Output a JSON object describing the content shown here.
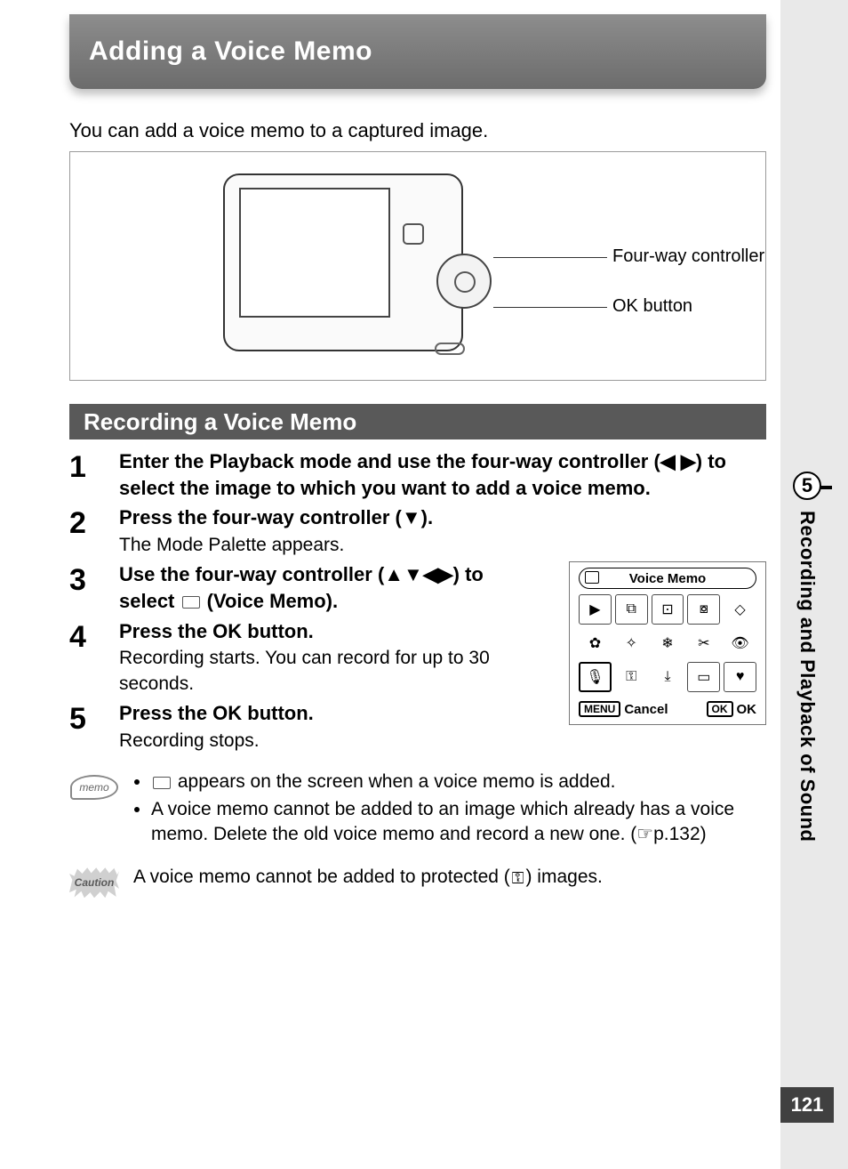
{
  "header": {
    "title": "Adding a Voice Memo"
  },
  "intro": "You can add a voice memo to a captured image.",
  "figure": {
    "label_fourway": "Four-way controller",
    "label_ok": "OK button"
  },
  "section": {
    "title": "Recording a Voice Memo"
  },
  "steps": [
    {
      "num": "1",
      "head": "Enter the Playback mode and use the four-way controller (◀ ▶) to select the image to which you want to add a voice memo.",
      "sub": ""
    },
    {
      "num": "2",
      "head": "Press the four-way controller (▼).",
      "sub": "The Mode Palette appears."
    },
    {
      "num": "3",
      "head_a": "Use the four-way controller (▲▼◀▶) to select ",
      "head_b": " (Voice Memo).",
      "sub": ""
    },
    {
      "num": "4",
      "head": "Press the OK button.",
      "sub": "Recording starts. You can record for up to 30 seconds."
    },
    {
      "num": "5",
      "head": "Press the OK button.",
      "sub": "Recording stops."
    }
  ],
  "palette": {
    "title": "Voice Memo",
    "menu_label": "MENU",
    "cancel": "Cancel",
    "ok_label": "OK",
    "ok_btn": "OK",
    "cells": [
      "▶",
      "⧉",
      "⊡",
      "⧇",
      "◇",
      "✿",
      "✧",
      "❄",
      "✂",
      "👁",
      "🎙",
      "⚿",
      "⤓",
      "▭",
      "♥"
    ]
  },
  "memo": {
    "icon_text": "memo",
    "bullet1_a": "",
    "bullet1_b": " appears on the screen when a voice memo is added.",
    "bullet2": "A voice memo cannot be added to an image which already has a voice memo. Delete the old voice memo and record a new one. (☞p.132)"
  },
  "caution": {
    "icon_text": "Caution",
    "text_a": "A voice memo cannot be added to protected (",
    "text_b": ") images."
  },
  "side": {
    "chapter_num": "5",
    "chapter_title": "Recording and Playback of Sound",
    "page_number": "121"
  }
}
